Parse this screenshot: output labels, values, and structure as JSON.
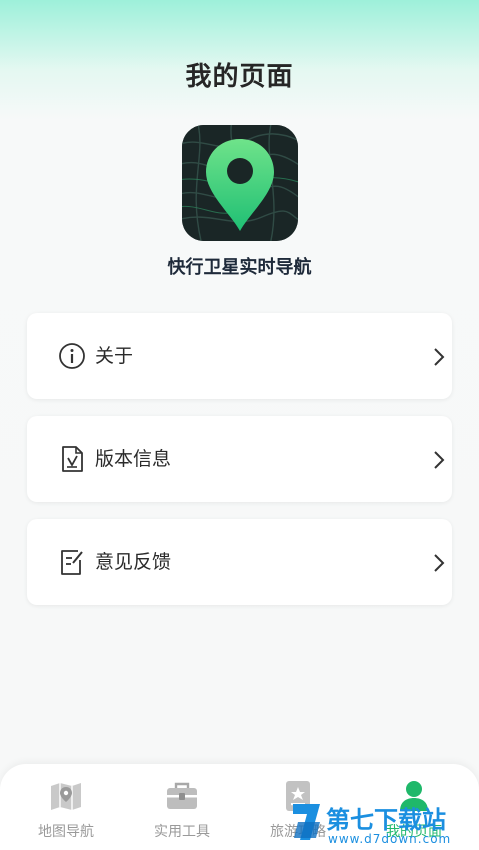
{
  "header": {
    "title": "我的页面"
  },
  "app": {
    "name": "快行卫星实时导航"
  },
  "menu": [
    {
      "label": "关于",
      "icon": "info-icon"
    },
    {
      "label": "版本信息",
      "icon": "document-check-icon"
    },
    {
      "label": "意见反馈",
      "icon": "edit-note-icon"
    }
  ],
  "tabs": [
    {
      "label": "地图导航",
      "icon": "map-pin-icon",
      "active": false
    },
    {
      "label": "实用工具",
      "icon": "toolbox-icon",
      "active": false
    },
    {
      "label": "旅游攻略",
      "icon": "guide-book-icon",
      "active": false
    },
    {
      "label": "我的页面",
      "icon": "profile-icon",
      "active": true
    }
  ],
  "watermark": {
    "text": "第七下载站",
    "url": "www.d7down.com"
  },
  "colors": {
    "accent": "#1fb86a",
    "header_gradient": "#9df0da",
    "watermark": "#1b8fe0"
  }
}
